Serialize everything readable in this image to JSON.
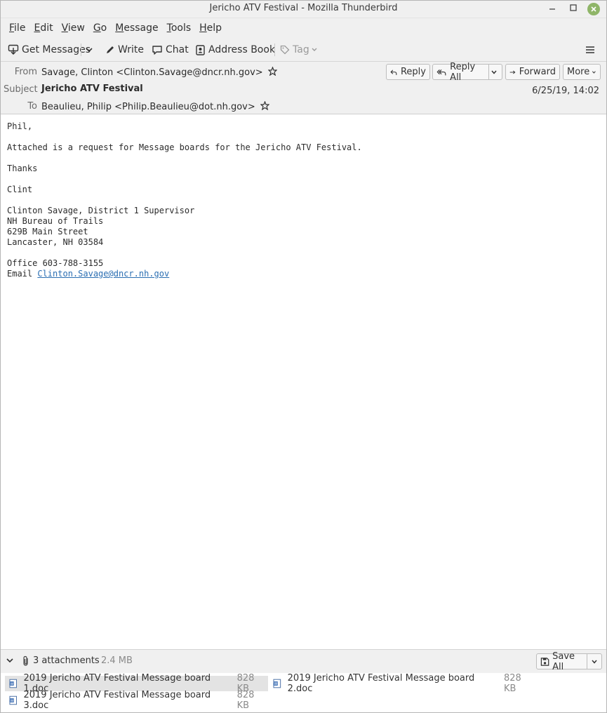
{
  "window": {
    "title": "Jericho ATV Festival - Mozilla Thunderbird"
  },
  "menubar": {
    "items": [
      {
        "label": "File",
        "key": "F",
        "rest": "ile"
      },
      {
        "label": "Edit",
        "key": "E",
        "rest": "dit"
      },
      {
        "label": "View",
        "key": "V",
        "rest": "iew"
      },
      {
        "label": "Go",
        "key": "G",
        "rest": "o"
      },
      {
        "label": "Message",
        "key": "M",
        "rest": "essage"
      },
      {
        "label": "Tools",
        "key": "T",
        "rest": "ools"
      },
      {
        "label": "Help",
        "key": "H",
        "rest": "elp"
      }
    ]
  },
  "toolbar": {
    "get_messages": "Get Messages",
    "write": "Write",
    "chat": "Chat",
    "address_book": "Address Book",
    "tag": "Tag"
  },
  "header": {
    "from_label": "From",
    "from_value": "Savage, Clinton <Clinton.Savage@dncr.nh.gov>",
    "subject_label": "Subject",
    "subject_value": "Jericho ATV Festival",
    "to_label": "To",
    "to_value": "Beaulieu, Philip <Philip.Beaulieu@dot.nh.gov>",
    "date": "6/25/19, 14:02",
    "reply": "Reply",
    "reply_all": "Reply All",
    "forward": "Forward",
    "more": "More"
  },
  "body": {
    "greeting": "Phil,",
    "line1": "Attached is a request for Message boards for the Jericho ATV Festival.",
    "thanks": "Thanks",
    "name": "Clint",
    "sig1": "Clinton Savage, District 1 Supervisor",
    "sig2": "NH Bureau of Trails",
    "sig3": "629B Main Street",
    "sig4": "Lancaster, NH 03584",
    "office": "Office 603-788-3155",
    "email_label": "Email ",
    "email_link": "Clinton.Savage@dncr.nh.gov"
  },
  "attachments": {
    "count_label": "3 attachments",
    "total_size": "2.4 MB",
    "save_all": "Save All",
    "items": [
      {
        "name": "2019 Jericho ATV Festival Message board 1.doc",
        "size": "828 KB"
      },
      {
        "name": "2019 Jericho ATV Festival Message board 2.doc",
        "size": "828 KB"
      },
      {
        "name": "2019 Jericho ATV Festival Message board 3.doc",
        "size": "828 KB"
      }
    ]
  }
}
